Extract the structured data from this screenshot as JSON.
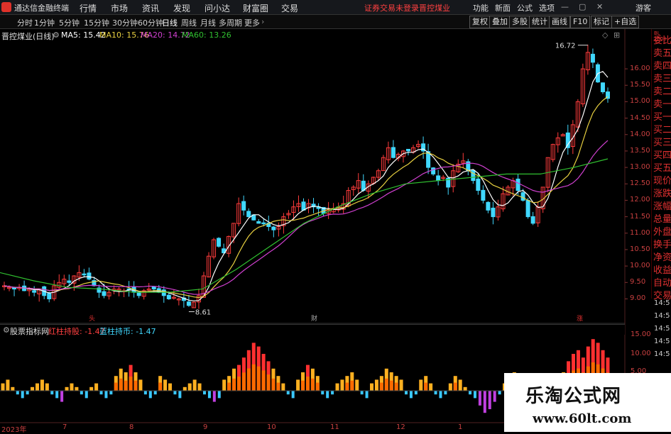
{
  "app": {
    "title": "通达信金融终端",
    "warning": "证券交易未登录",
    "stock_link": "晋控煤业"
  },
  "menu": [
    "行情",
    "市场",
    "资讯",
    "发现",
    "问小达",
    "财富圈",
    "交易"
  ],
  "right_menu": [
    "功能",
    "新面",
    "公式",
    "选项",
    "游客"
  ],
  "toolbar": {
    "periods": [
      "分时",
      "1分钟",
      "5分钟",
      "15分钟",
      "30分钟",
      "60分钟",
      "日线",
      "周线",
      "月线",
      "多周期",
      "更多"
    ],
    "active": "日线",
    "right_buttons": [
      "复权",
      "叠加",
      "多股",
      "统计",
      "画线",
      "F10",
      "标记",
      "+自选"
    ]
  },
  "stock_header": {
    "name": "晋控煤业(日线)",
    "ma5": "MA5: 15.42",
    "ma10": "MA10: 15.76",
    "ma20": "MA20: 14.72",
    "ma60": "MA60: 13.26"
  },
  "colors": {
    "up": "#ff3c3c",
    "down": "#40d8ff",
    "ma5": "#ffffff",
    "ma10": "#e8d040",
    "ma20": "#d040d0",
    "ma60": "#30c030"
  },
  "price_axis": [
    "16.00",
    "15.50",
    "15.00",
    "14.50",
    "14.00",
    "13.50",
    "13.00",
    "12.50",
    "12.00",
    "11.50",
    "11.00",
    "10.50",
    "10.00",
    "9.50",
    "9.00"
  ],
  "annotations": {
    "high": "16.72",
    "low": "8.61",
    "mark1": "头",
    "mark2": "财",
    "mark3": "涨"
  },
  "sidebar_items": [
    "委比",
    "卖五",
    "卖四",
    "卖三",
    "卖二",
    "卖一",
    "买一",
    "买二",
    "买三",
    "买四",
    "买五",
    "现价",
    "涨跌",
    "涨幅",
    "总量",
    "外盘",
    "换手",
    "净资",
    "收益",
    "自动",
    "交易"
  ],
  "sidebar_small": "BL 1000",
  "time_axis": [
    "14:5",
    "14:5",
    "14:5",
    "14:5",
    "14:5"
  ],
  "indicator": {
    "name": "股票指标网",
    "red_label": "红柱持股: -1.47",
    "blue_label": "蓝柱持币: -1.47",
    "axis": [
      "15.00",
      "10.00",
      "5.00"
    ]
  },
  "dates": [
    "2023年",
    "7",
    "8",
    "9",
    "10",
    "11",
    "12",
    "1"
  ],
  "watermark": {
    "title": "乐淘公式网",
    "url": "www.60lt.com"
  },
  "chart_data": {
    "type": "candlestick",
    "title": "晋控煤业(日线)",
    "ylim": [
      8.6,
      16.8
    ],
    "closes": [
      9.4,
      9.35,
      9.3,
      9.35,
      9.25,
      9.3,
      9.2,
      9.3,
      9.1,
      9.0,
      9.4,
      9.5,
      9.6,
      9.5,
      9.7,
      9.8,
      9.75,
      9.6,
      9.4,
      9.2,
      9.1,
      9.2,
      9.3,
      9.3,
      9.25,
      9.3,
      9.2,
      9.1,
      9.25,
      9.3,
      9.3,
      9.2,
      9.1,
      9.0,
      9.05,
      9.0,
      8.95,
      8.8,
      8.9,
      9.1,
      9.7,
      10.3,
      10.8,
      10.6,
      10.4,
      10.9,
      11.3,
      11.9,
      11.7,
      11.5,
      11.4,
      11.3,
      11.3,
      11.2,
      11.1,
      11.2,
      11.5,
      11.6,
      11.8,
      11.9,
      11.7,
      11.9,
      11.8,
      11.75,
      11.6,
      11.7,
      11.75,
      11.8,
      11.9,
      12.3,
      12.4,
      12.6,
      12.3,
      12.5,
      12.7,
      12.9,
      13.3,
      13.6,
      13.3,
      13.4,
      13.5,
      13.5,
      13.6,
      13.7,
      13.5,
      13.0,
      12.8,
      12.6,
      12.7,
      12.4,
      12.9,
      13.1,
      13.2,
      12.9,
      12.6,
      12.3,
      12.0,
      11.7,
      11.5,
      11.8,
      12.2,
      12.4,
      12.6,
      12.3,
      12.0,
      11.5,
      11.3,
      11.8,
      12.4,
      13.3,
      13.7,
      13.9,
      14.0,
      13.6,
      14.3,
      15.0,
      16.0,
      16.5,
      16.2,
      15.6,
      15.3,
      15.1
    ],
    "ma60_points": [
      9.8,
      9.55,
      9.35,
      9.3,
      9.2,
      9.2,
      9.3,
      9.9,
      10.6,
      11.3,
      11.8,
      12.2,
      12.5,
      12.6,
      12.7,
      12.8,
      12.8,
      13.0,
      13.26
    ],
    "indicator_values": [
      2,
      3,
      1,
      -1,
      -2,
      -1,
      1,
      2,
      3,
      2,
      -1,
      -2,
      -3,
      1,
      2,
      1,
      -1,
      -2,
      1,
      2,
      -1,
      -2,
      -1,
      4,
      6,
      5,
      7,
      5,
      3,
      -1,
      -2,
      -1,
      4,
      3,
      2,
      -1,
      -2,
      1,
      2,
      3,
      2,
      -1,
      -2,
      -3,
      -2,
      3,
      4,
      6,
      7,
      9,
      11,
      13,
      12,
      10,
      8,
      6,
      4,
      2,
      -1,
      -2,
      3,
      5,
      7,
      6,
      4,
      -1,
      -2,
      -1,
      2,
      3,
      4,
      5,
      3,
      -1,
      -2,
      2,
      3,
      4,
      6,
      5,
      4,
      3,
      -1,
      -2,
      -1,
      3,
      4,
      2,
      -1,
      -2,
      -1,
      2,
      4,
      3,
      1,
      -1,
      -2,
      -4,
      -6,
      -5,
      -3,
      -1,
      2,
      4,
      5,
      3,
      -1,
      -2,
      -3,
      -2,
      -4,
      -5,
      -6,
      2,
      5,
      8,
      10,
      11,
      9,
      12,
      14,
      13,
      11,
      9
    ]
  }
}
